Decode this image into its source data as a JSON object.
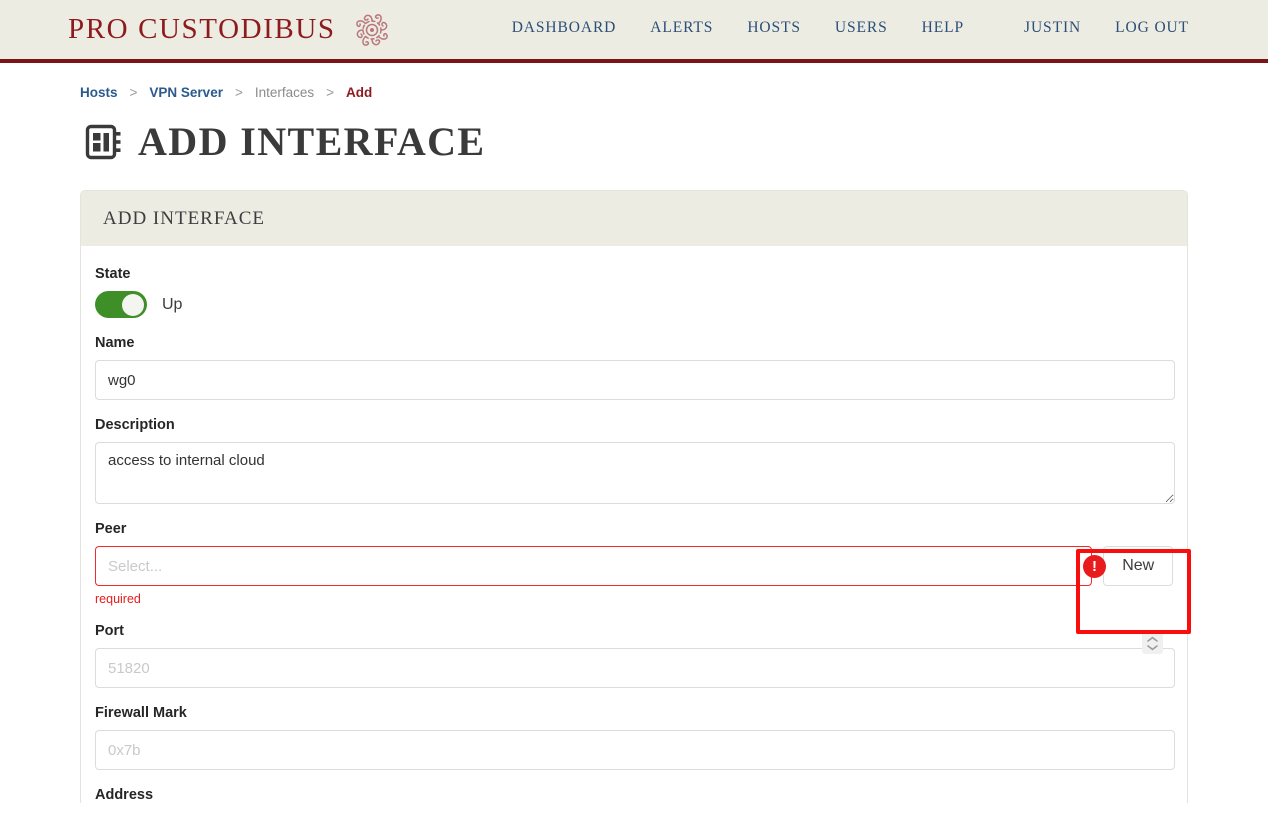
{
  "header": {
    "brand_text": "PRO CUSTODIBUS",
    "brand_logo_name": "medusa-head-logo",
    "nav": [
      {
        "label": "DASHBOARD",
        "name": "nav-dashboard"
      },
      {
        "label": "ALERTS",
        "name": "nav-alerts"
      },
      {
        "label": "HOSTS",
        "name": "nav-hosts"
      },
      {
        "label": "USERS",
        "name": "nav-users"
      },
      {
        "label": "HELP",
        "name": "nav-help"
      },
      {
        "label": "JUSTIN",
        "name": "nav-account-justin"
      },
      {
        "label": "LOG OUT",
        "name": "nav-log-out"
      }
    ]
  },
  "breadcrumb": {
    "items": [
      {
        "label": "Hosts"
      },
      {
        "label": "VPN Server"
      },
      {
        "label": "Interfaces"
      },
      {
        "label": "Add"
      }
    ],
    "separator": ">"
  },
  "page": {
    "title": "ADD INTERFACE",
    "icon": "interface-chip-icon"
  },
  "card": {
    "title": "ADD INTERFACE"
  },
  "form": {
    "state": {
      "label": "State",
      "toggle_on": true,
      "toggle_text": "Up"
    },
    "name": {
      "label": "Name",
      "value": "wg0",
      "placeholder": ""
    },
    "description": {
      "label": "Description",
      "value": "access to internal cloud",
      "placeholder": ""
    },
    "peer": {
      "label": "Peer",
      "placeholder": "Select...",
      "value": "",
      "error": "required",
      "error_badge": "!",
      "new_button": "New"
    },
    "port": {
      "label": "Port",
      "placeholder": "51820",
      "value": ""
    },
    "firewall_mark": {
      "label": "Firewall Mark",
      "placeholder": "0x7b",
      "value": ""
    },
    "next_field": {
      "label": "Address"
    }
  },
  "colors": {
    "brand_red": "#8d1b1e",
    "header_bg": "#edece3",
    "nav_blue": "#2b4f77",
    "toggle_green": "#3f8f29",
    "error_red": "#e81c1c",
    "annotation_red": "#fa0d0d"
  }
}
